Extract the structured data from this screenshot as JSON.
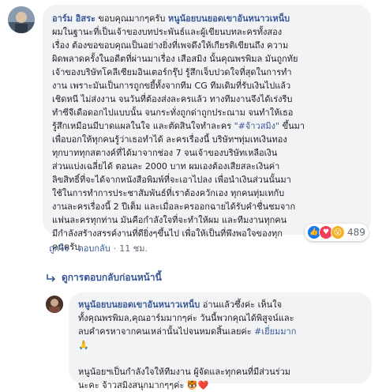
{
  "comment1": {
    "author": "อาร์ม อิสระ",
    "lines": [
      {
        "pre": "ขอบคุณมากๆครับ ",
        "tag": "หนูน้อยบนยอดเขาอันหนาวเหน็บ",
        "post": ""
      },
      {
        "pre": "ผมในฐานะที่เป็นเจ้าของบทประพันธ์และผู้เขียนบทละครทั้งสอง",
        "tag": "",
        "post": ""
      },
      {
        "pre": "เรื่อง ต้องขอขอบคุณเป็นอย่างยิ่งที่เพจดึงให้เกียรติเขียนถึง ความ",
        "tag": "",
        "post": ""
      },
      {
        "pre": "ผิดพลาดครั้งในอดีตที่ผ่านมาเรื่อง เสือสมิง นั้นคุณพรพิมล มันถูกทัย",
        "tag": "",
        "post": ""
      },
      {
        "pre": "เจ้าของบริษัทโคลีเซียมอินเตอร์กรุ๊ป รู้สึกเจ็บปวดใจที่สุดในการทำ",
        "tag": "",
        "post": ""
      },
      {
        "pre": "งาน เพราะมันเป็นการถูกขยี้ทั้งจากทีม CG ทีมเดิมที่รับเงินไปแล้ว",
        "tag": "",
        "post": ""
      },
      {
        "pre": "เชิดหนี ไม่ส่งงาน จนวันที่ต้องส่งละครแล้ว ทางทีมงานจึงได้เร่งรีบ",
        "tag": "",
        "post": ""
      },
      {
        "pre": "ทำซีจีเดือดอกไปแบบนั้น จนกระทั่งถูกด่าถูกประณาม จนทำให้เธอ",
        "tag": "",
        "post": ""
      },
      {
        "pre": "รู้สึกเหมือนมีบาดแผลในใจ และตัดสินใจทำละคร ",
        "hashtag": "\"#จ้าวสมิง\"",
        "post": " ขึ้นมา"
      },
      {
        "pre": "เพื่อบอกให้ทุกคนรู้ว่าเธอทำได้ ละครเรื่องนี้ บริษัทฯทุ่มเทเงินทอง",
        "tag": "",
        "post": ""
      },
      {
        "pre": "ทุกบาททุกสตางค์ที่ได้มาจากช่อง 7 จนเจ้าของบริษัทเหลือเงิน",
        "tag": "",
        "post": ""
      },
      {
        "pre": "ส่วนแบ่งเฉลี่ยได้ ตอนละ 2000 บาท ผมเองต้องเสียสละเงินค่า",
        "tag": "",
        "post": ""
      },
      {
        "pre": "ลิขสิทธิ์ที่จะได้จากหนังสือพิมพ์ที่จะเอาไปลง เพื่อนำเงินส่วนนั้นมา",
        "tag": "",
        "post": ""
      },
      {
        "pre": "ใช้ในการทำการประชาสัมพันธ์ที่เราต้องควักเอง ทุกคนทุ่มเทกับ",
        "tag": "",
        "post": ""
      },
      {
        "pre": "งานละครเรื่องนี้ 2 ปีเต็ม และเมื่อละครออกฉายได้รับคำชื่นชมจาก",
        "tag": "",
        "post": ""
      },
      {
        "pre": "แฟนละครทุกท่าน มันคือกำลังใจที่จะทำให้ผม และทีมงานทุกคน",
        "tag": "",
        "post": ""
      },
      {
        "pre": "มีกำลังสร้างสรรค์งานที่ดียิ่งๆขึ้นไป เพื่อให้เป็นที่พึงพอใจของทุก",
        "tag": "",
        "post": ""
      },
      {
        "pre": "คนครับ",
        "tag": "",
        "post": ""
      }
    ],
    "like_label": "ถูกใจ",
    "reply_label": "ตอบกลับ",
    "time": "11 ชม.",
    "reaction_count": "489"
  },
  "previous_replies_label": "ดูการตอบกลับก่อนหน้านี้",
  "comment2": {
    "author": "หนูน้อยบนยอดเขาอันหนาวเหน็บ",
    "lines": [
      {
        "pre": " อ่านแล้วซึ้งค่ะ เห็นใจ",
        "hashtag": ""
      },
      {
        "pre": "ทั้งคุณพรพิมล,คุณอาร์มมากๆค่ะ วันนี้พวกคุณได้พิสูจน์และ",
        "hashtag": ""
      },
      {
        "pre": "ลบคำครหาจากคนเหล่านั้นไปจนหมดสิ้นเลยค่ะ ",
        "hashtag": "#เยี่ยมมาก"
      },
      {
        "pre": "🙏",
        "hashtag": ""
      },
      {
        "pre": "",
        "hashtag": ""
      },
      {
        "pre": "หนูน้อยฯเป็นกำลังใจให้ทีมงาน ผู้จัดและทุกคนที่มีส่วนร่วม",
        "hashtag": ""
      },
      {
        "pre": "นะคะ จ้าวสมิงสนุกมากๆๆค่ะ 🐯❤️",
        "hashtag": ""
      }
    ]
  }
}
